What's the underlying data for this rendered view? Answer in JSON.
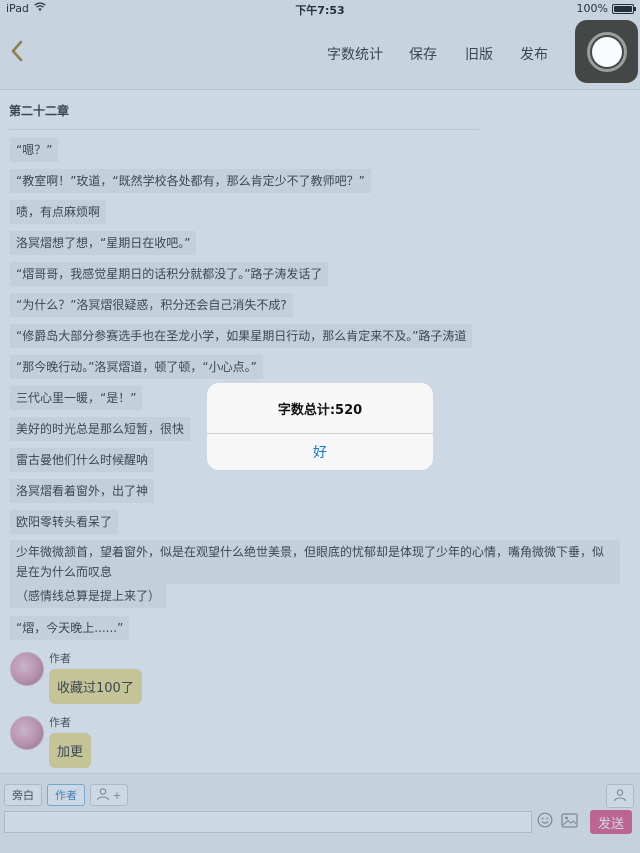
{
  "status_bar": {
    "device": "iPad",
    "time": "下午7:53",
    "battery": "100%",
    "battery_level": 1.0
  },
  "nav": {
    "stats_label": "字数统计",
    "save_label": "保存",
    "old_version_label": "旧版",
    "publish_label": "发布"
  },
  "chapter": {
    "title": "第二十二章"
  },
  "paragraphs": [
    "“嗯？”",
    "“教室啊！”玫道，“既然学校各处都有，那么肯定少不了教师吧？”",
    "啧，有点麻烦啊",
    "洛冥熠想了想，“星期日在收吧。”",
    "“熠哥哥，我感觉星期日的话积分就都没了。”路子涛发话了",
    "“为什么？”洛冥熠很疑惑，积分还会自己消失不成?",
    "“修爵岛大部分参赛选手也在圣龙小学，如果星期日行动，那么肯定来不及。”路子涛道",
    "“那今晚行动。”洛冥熠道，顿了顿，“小心点。”",
    "三代心里一暖，“是！”",
    "美好的时光总是那么短暂，很快",
    "雷古曼他们什么时候醒呐",
    "洛冥熠看着窗外，出了神",
    "欧阳零转头看呆了",
    "少年微微颔首，望着窗外，似是在观望什么绝世美景，但眼底的忧郁却是体现了少年的心情，嘴角微微下垂，似是在为什么而叹息",
    "（感情线总算是提上来了）",
    "“熠，今天晚上......”"
  ],
  "comments": [
    {
      "author": "作者",
      "text": "收藏过100了"
    },
    {
      "author": "作者",
      "text": "加更"
    }
  ],
  "bottom": {
    "narration_label": "旁白",
    "author_label": "作者",
    "add_role_label": "+",
    "input_value": "",
    "send_label": "发送"
  },
  "alert": {
    "title": "字数总计:520",
    "ok_label": "好"
  },
  "colors": {
    "send_button": "#e84f80",
    "alert_button_text": "#1976d2",
    "bubble": "#f3df87",
    "overlay": "#6991b4"
  },
  "icons": [
    "wifi-icon",
    "back-chevron-icon",
    "assistive-touch-icon",
    "person-add-icon",
    "person-icon",
    "emoji-icon",
    "image-icon"
  ]
}
